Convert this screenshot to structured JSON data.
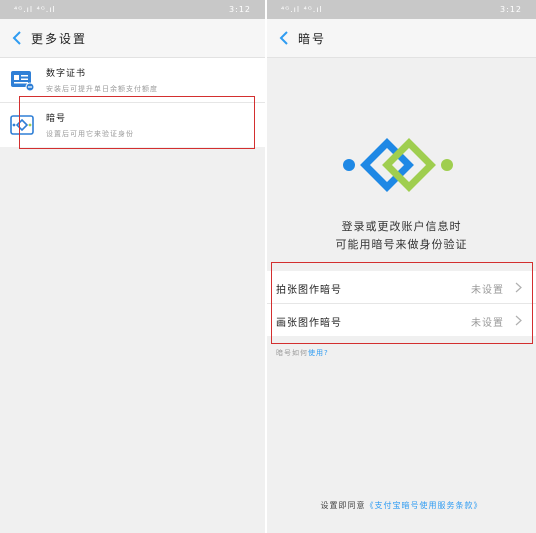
{
  "left": {
    "status": {
      "signal": "⁴ᴳ.ıl ⁴ᴳ.ıl",
      "right": "3:12"
    },
    "title": "更多设置",
    "items": [
      {
        "title": "数字证书",
        "subtitle": "安装后可提升单日余额支付额度",
        "icon": "certificate-icon"
      },
      {
        "title": "暗号",
        "subtitle": "设置后可用它来验证身份",
        "icon": "secret-code-icon"
      }
    ]
  },
  "right": {
    "status": {
      "signal": "⁴ᴳ.ıl ⁴ᴳ.ıl",
      "right": "3:12"
    },
    "title": "暗号",
    "desc_line1": "登录或更改账户信息时",
    "desc_line2": "可能用暗号来做身份验证",
    "options": [
      {
        "label": "拍张图作暗号",
        "value": "未设置"
      },
      {
        "label": "画张图作暗号",
        "value": "未设置"
      }
    ],
    "help_prefix": "暗号如何",
    "help_link": "使用?",
    "agree_prefix": "设置即同意",
    "agree_link": "《支付宝暗号使用服务条款》"
  },
  "colors": {
    "accent": "#2f9cf2",
    "green": "#9fce4f",
    "blue": "#1e88e5",
    "highlight": "#d32f2f"
  }
}
